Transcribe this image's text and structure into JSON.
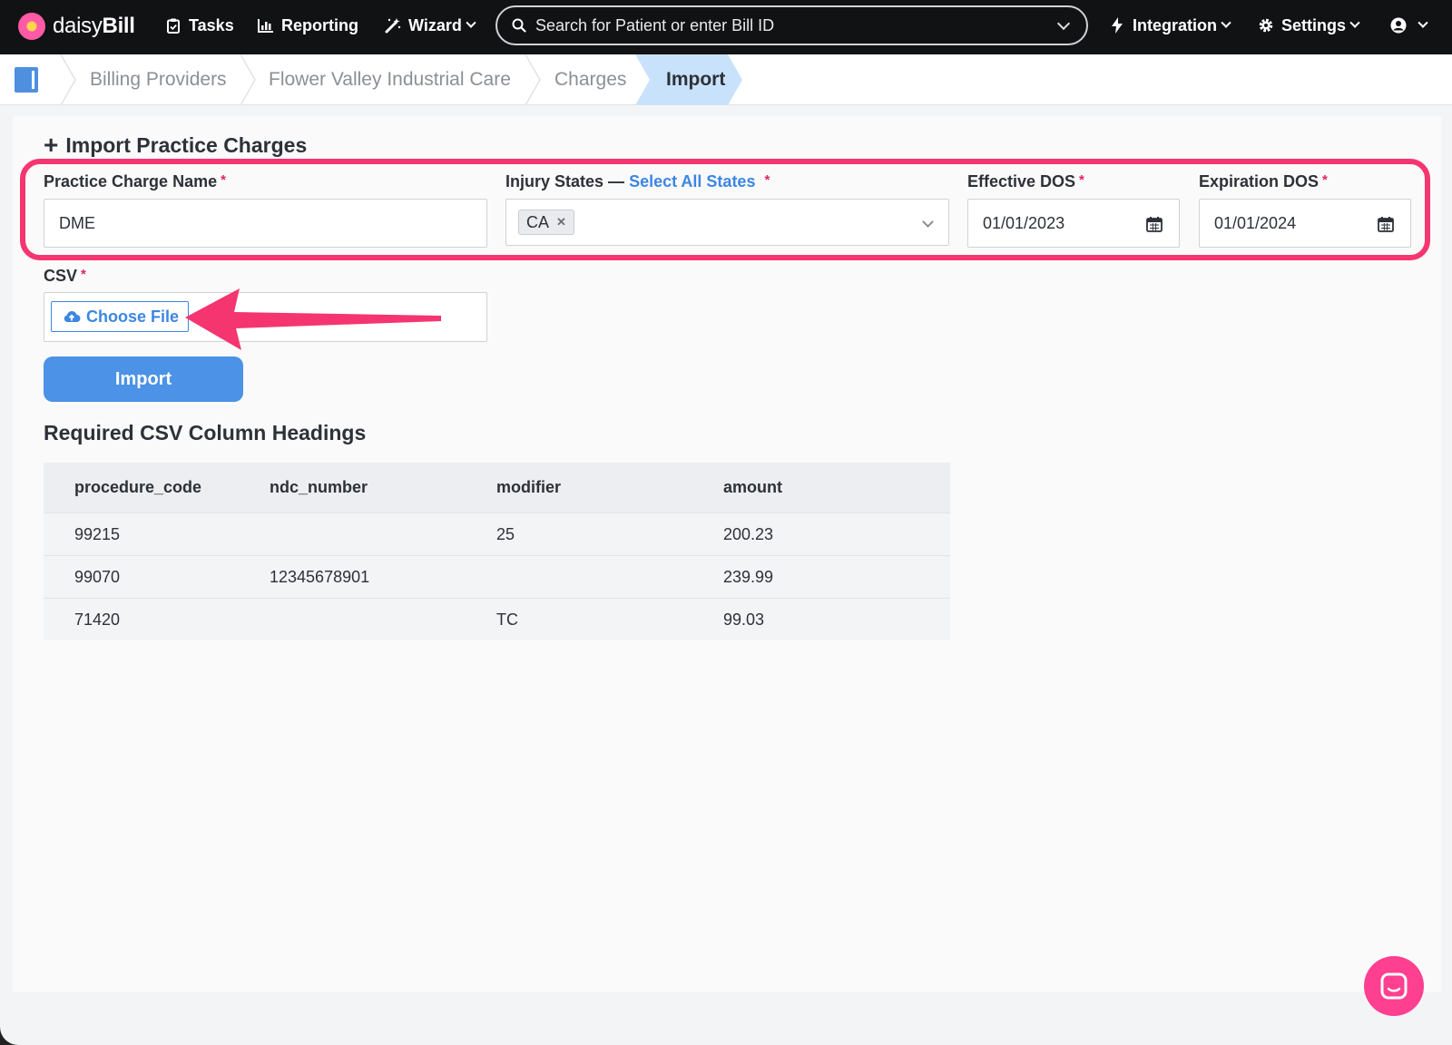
{
  "app": {
    "brand_light": "daisy",
    "brand_bold": "Bill"
  },
  "nav": {
    "tasks": "Tasks",
    "reporting": "Reporting",
    "wizard": "Wizard",
    "integration": "Integration",
    "settings": "Settings"
  },
  "search": {
    "placeholder": "Search for Patient or enter Bill ID"
  },
  "breadcrumb": {
    "items": [
      "Billing Providers",
      "Flower Valley Industrial Care",
      "Charges"
    ],
    "active": "Import"
  },
  "form": {
    "title": "Import Practice Charges",
    "charge_name_label": "Practice Charge Name",
    "charge_name_value": "DME",
    "injury_states_label": "Injury States —",
    "select_all_link": "Select All States",
    "injury_states_selected": [
      "CA"
    ],
    "effective_label": "Effective DOS",
    "effective_value": "01/01/2023",
    "expiration_label": "Expiration DOS",
    "expiration_value": "01/01/2024",
    "csv_label": "CSV",
    "choose_file": "Choose File",
    "import_button": "Import",
    "required_mark": "*"
  },
  "csv_table": {
    "title": "Required CSV Column Headings",
    "headers": [
      "procedure_code",
      "ndc_number",
      "modifier",
      "amount"
    ],
    "rows": [
      [
        "99215",
        "",
        "25",
        "200.23"
      ],
      [
        "99070",
        "12345678901",
        "",
        "239.99"
      ],
      [
        "71420",
        "",
        "TC",
        "99.03"
      ]
    ]
  },
  "colors": {
    "accent": "#3c86e4",
    "highlight": "#f5356f",
    "nav_bg": "#111214"
  }
}
